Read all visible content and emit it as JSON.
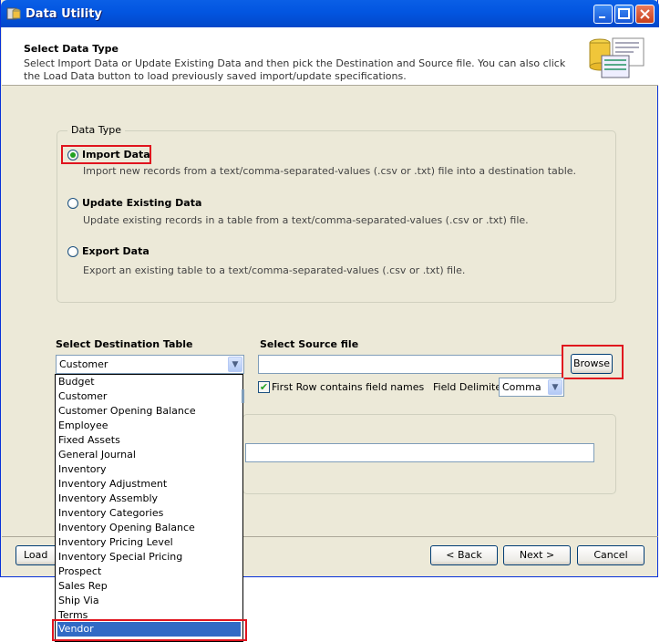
{
  "window": {
    "title": "Data Utility"
  },
  "header": {
    "title": "Select Data Type",
    "description": "Select Import Data or Update Existing Data and then pick the Destination and Source file.  You can also click the Load Data button to load previously saved import/update specifications."
  },
  "data_type": {
    "legend": "Data Type",
    "options": [
      {
        "label": "Import Data",
        "description": "Import new records from a text/comma-separated-values (.csv or .txt) file into a destination table.",
        "selected": true
      },
      {
        "label": "Update Existing Data",
        "description": "Update existing records in a table from a text/comma-separated-values (.csv or .txt) file.",
        "selected": false
      },
      {
        "label": "Export Data",
        "description": "Export an existing table to a text/comma-separated-values (.csv or .txt) file.",
        "selected": false
      }
    ]
  },
  "destination": {
    "label": "Select Destination Table",
    "value": "Customer",
    "list": [
      "Budget",
      "Customer",
      "Customer Opening Balance",
      "Employee",
      "Fixed Assets",
      "General Journal",
      "Inventory",
      "Inventory Adjustment",
      "Inventory Assembly",
      "Inventory Categories",
      "Inventory Opening Balance",
      "Inventory Pricing Level",
      "Inventory Special Pricing",
      "Prospect",
      "Sales Rep",
      "Ship Via",
      "Terms",
      "Vendor"
    ],
    "highlighted": "Vendor"
  },
  "source": {
    "label": "Select Source file",
    "value": "",
    "browse_label": "Browse",
    "first_row_label": "First Row contains field names",
    "first_row_checked": true,
    "delimiter_label": "Field Delimiter",
    "delimiter_value": "Comma"
  },
  "buttons": {
    "load": "Load Da",
    "back": "< Back",
    "next": "Next >",
    "cancel": "Cancel"
  },
  "colors": {
    "title_bar": "#0255e0",
    "highlight": "#e0141e",
    "selection": "#316ac5"
  }
}
